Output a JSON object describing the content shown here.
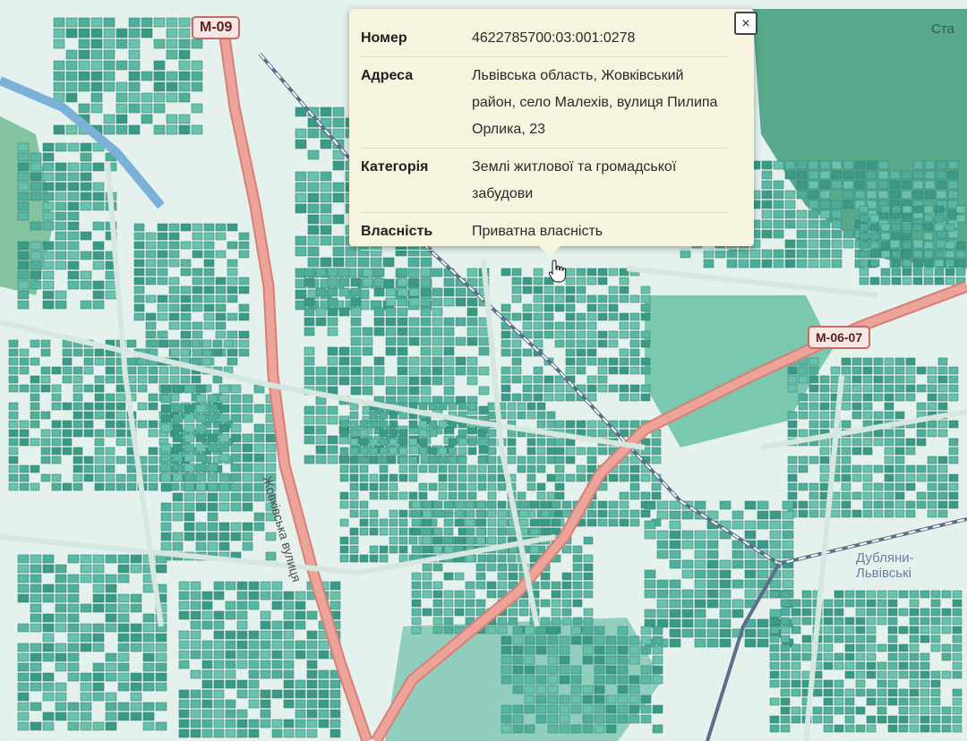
{
  "map": {
    "road_labels": {
      "m09": "М-09",
      "m0607": "М-06-07"
    },
    "street_label": "Жовківська вулиця",
    "place_label": {
      "line1": "Дубляни-",
      "line2": "Львівські"
    },
    "corner_label": "Ста",
    "colors": {
      "background": "#e4f1ec",
      "parcel": "#5ab7a4",
      "parcel_dark": "#3a9a86",
      "main_road": "#e3938a",
      "railway": "#5b6f88",
      "forest": "#3f9b7a"
    }
  },
  "popup": {
    "close_icon": "×",
    "rows": [
      {
        "key": "Номер",
        "value": "4622785700:03:001:0278"
      },
      {
        "key": "Адреса",
        "value": "Львівська область, Жовківський район, село Малехів, вулиця Пилипа Орлика, 23"
      },
      {
        "key": "Категорія",
        "value": "Землі житлової та громадської забудови"
      },
      {
        "key": "Власність",
        "value": "Приватна власність"
      }
    ]
  },
  "cursor_icon": "hand-pointer-icon"
}
